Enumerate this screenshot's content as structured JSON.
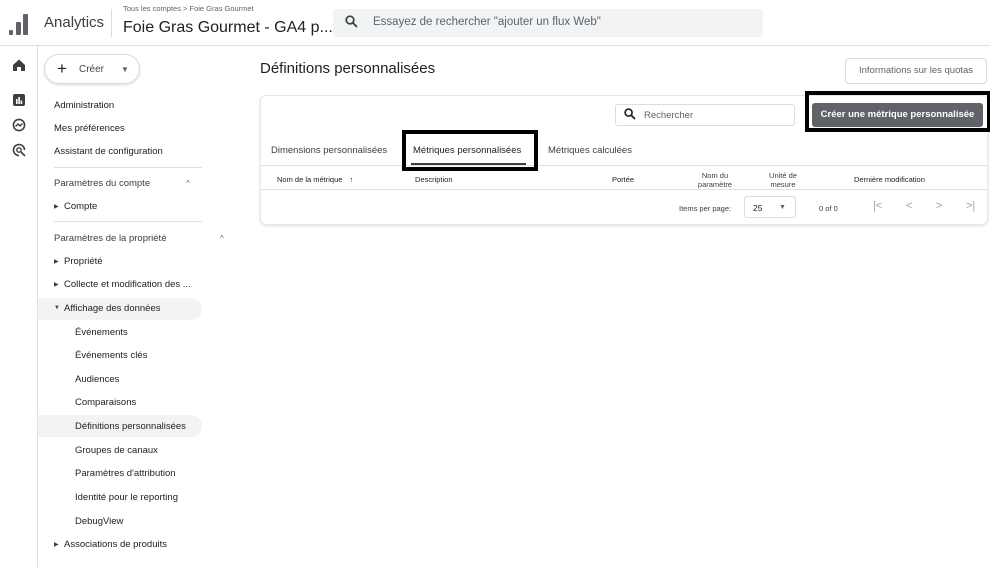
{
  "header": {
    "app_name": "Analytics",
    "breadcrumb": "Tous les comptes > Foie Gras Gourmet",
    "property": "Foie Gras Gourmet - GA4 p...",
    "property_caret": "▾",
    "search_icon": "search-icon",
    "search_placeholder": "Essayez de rechercher \"ajouter un flux Web\""
  },
  "rail": [
    "home-icon",
    "reports-icon",
    "explore-icon",
    "advertising-icon"
  ],
  "nav": {
    "create_label": "Créer",
    "top_items": [
      "Administration",
      "Mes préférences",
      "Assistant de configuration"
    ],
    "account_section": "Paramètres du compte",
    "account_tree": [
      "Compte"
    ],
    "property_section": "Paramètres de la propriété",
    "property_tree": [
      "Propriété",
      "Collecte et modification des ...",
      "Affichage des données"
    ],
    "data_display_items": [
      "Événements",
      "Événements clés",
      "Audiences",
      "Comparaisons",
      "Définitions personnalisées",
      "Groupes de canaux",
      "Paramètres d'attribution",
      "Identité pour le reporting",
      "DebugView"
    ],
    "bottom_tree": [
      "Associations de produits"
    ],
    "selected": "Définitions personnalisées"
  },
  "main": {
    "title": "Définitions personnalisées",
    "quota_button": "Informations sur les quotas",
    "search_placeholder": "Rechercher",
    "create_button": "Créer une métrique personnalisée",
    "tabs": [
      "Dimensions personnalisées",
      "Métriques personnalisées",
      "Métriques calculées"
    ],
    "active_tab": "Métriques personnalisées",
    "columns": {
      "name": "Nom de la métrique",
      "sort_arrow": "↑",
      "description": "Description",
      "scope": "Portée",
      "param_line1": "Nom du",
      "param_line2": "paramètre",
      "unit_line1": "Unité de",
      "unit_line2": "mesure",
      "modified": "Dernière modification"
    },
    "pager": {
      "items_per_page_label": "Items per page:",
      "items_per_page": "25",
      "count": "0 of 0",
      "first": "|<",
      "prev": "<",
      "next": ">",
      "last": ">|"
    }
  },
  "colors": {
    "primary_button": "#5f6368",
    "highlight_border": "#000000",
    "selected_bg": "#f1f3f4"
  }
}
